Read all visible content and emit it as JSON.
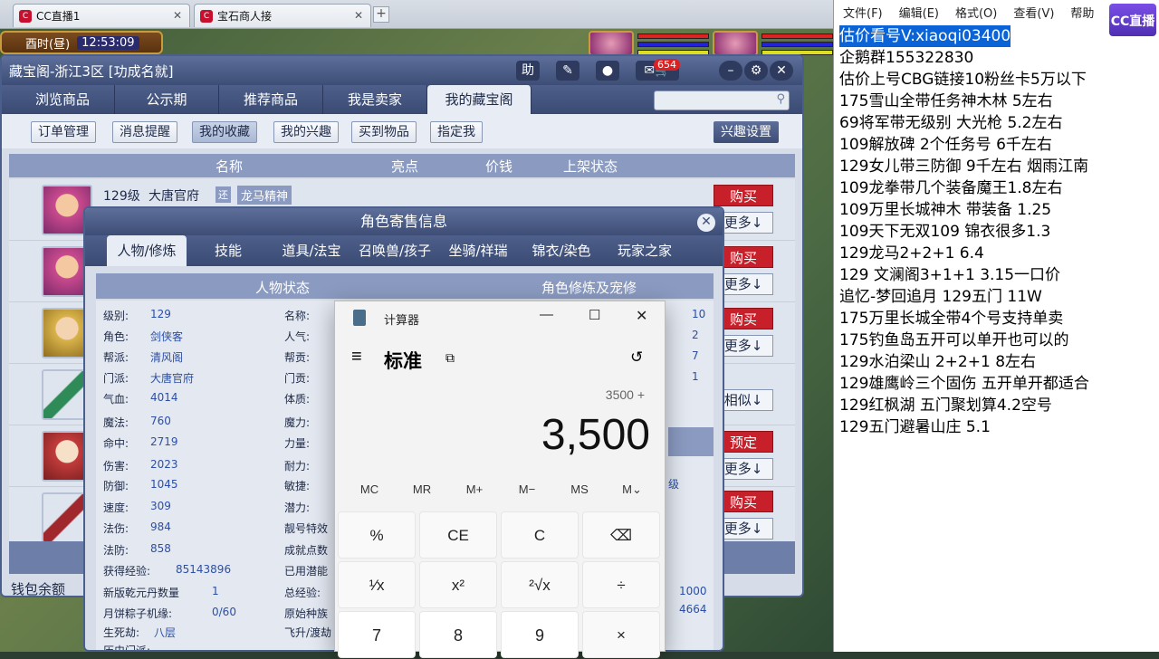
{
  "browser": {
    "tabs": [
      {
        "label": "CC直播1",
        "close": "✕"
      },
      {
        "label": "宝石商人接",
        "close": "✕"
      }
    ],
    "new_tab": "+"
  },
  "game": {
    "time_label": "酉时(昼)",
    "clock": "12:53:09"
  },
  "market": {
    "title": "藏宝阁-浙江3区 [功成名就]",
    "help_label": "助",
    "message_count": "654",
    "nav_tabs": [
      "浏览商品",
      "公示期",
      "推荐商品",
      "我是卖家",
      "我的藏宝阁"
    ],
    "active_tab": 4,
    "sub_buttons": [
      "订单管理",
      "消息提醒",
      "我的收藏",
      "我的兴趣",
      "买到物品",
      "指定我"
    ],
    "interest_settings": "兴趣设置",
    "columns": [
      "名称",
      "亮点",
      "价钱",
      "上架状态"
    ],
    "first_item": {
      "level": "129级",
      "school": "大唐官府",
      "tag1": "还",
      "tag2": "龙马精神"
    },
    "buy_label": "购买",
    "more_label": "更多↓",
    "similar_label": "相似↓",
    "reserve_label": "预定",
    "wallet_label": "钱包余额"
  },
  "role_dialog": {
    "title": "角色寄售信息",
    "close": "✕",
    "tabs": [
      "人物/修炼",
      "技能",
      "道具/法宝",
      "召唤兽/孩子",
      "坐骑/祥瑞",
      "锦衣/染色",
      "玩家之家"
    ],
    "section_left": "人物状态",
    "section_right": "角色修炼及宠修",
    "stats": [
      {
        "label": "级别:",
        "value": "129"
      },
      {
        "label": "角色:",
        "value": "剑侠客"
      },
      {
        "label": "帮派:",
        "value": "清风阁"
      },
      {
        "label": "门派:",
        "value": "大唐官府"
      },
      {
        "label": "气血:",
        "value": "4014"
      },
      {
        "label": "魔法:",
        "value": "760"
      },
      {
        "label": "命中:",
        "value": "2719"
      },
      {
        "label": "伤害:",
        "value": "2023"
      },
      {
        "label": "防御:",
        "value": "1045"
      },
      {
        "label": "速度:",
        "value": "309"
      },
      {
        "label": "法伤:",
        "value": "984"
      },
      {
        "label": "法防:",
        "value": "858"
      },
      {
        "label": "获得经验:",
        "value": "85143896"
      },
      {
        "label": "新版乾元丹数量",
        "value": "1"
      },
      {
        "label": "月饼粽子机缘:",
        "value": "0/60"
      },
      {
        "label": "生死劫:",
        "value": "八层"
      },
      {
        "label": "历史门派:",
        "value": ""
      }
    ],
    "stats2": [
      "名称:",
      "人气:",
      "帮贡:",
      "门贡:",
      "体质:",
      "魔力:",
      "力量:",
      "耐力:",
      "敏捷:",
      "潜力:",
      "靓号特效",
      "成就点数",
      "已用潜能",
      "总经验:",
      "原始种族",
      "飞升/渡劫"
    ],
    "right_values": [
      "10",
      "2",
      "7",
      "1"
    ],
    "right_level": "级",
    "bottom_values": [
      "1000",
      "4664"
    ]
  },
  "calculator": {
    "title": "计算器",
    "mode": "标准",
    "expression": "3500 +",
    "display": "3,500",
    "memory": [
      "MC",
      "MR",
      "M+",
      "M−",
      "MS",
      "M⌄"
    ],
    "keys": [
      "%",
      "CE",
      "C",
      "⌫",
      "¹⁄x",
      "x²",
      "²√x",
      "÷",
      "7",
      "8",
      "9",
      "×"
    ]
  },
  "notepad": {
    "menu": [
      "文件(F)",
      "编辑(E)",
      "格式(O)",
      "查看(V)",
      "帮助"
    ],
    "logo": "CC直播",
    "lines": [
      "估价看号V:xiaoqi03400",
      "企鹅群155322830",
      "估价上号CBG链接10粉丝卡5万以下",
      "175雪山全带任务神木林 5左右",
      "69将军带无级别 大光枪 5.2左右",
      "109解放碑 2个任务号 6千左右",
      "129女儿带三防御 9千左右 烟雨江南",
      "109龙拳带几个装备魔王1.8左右",
      "109万里长城神木 带装备  1.25",
      "109天下无双109  锦衣很多1.3",
      "129龙马2+2+1  6.4",
      "129 文澜阁3+1+1   3.15一口价",
      "追忆-梦回追月 129五门 11W",
      "175万里长城全带4个号支持单卖",
      "175钓鱼岛五开可以单开也可以的",
      "129水泊梁山 2+2+1 8左右",
      "129雄鹰岭三个固伤 五开单开都适合",
      "129红枫湖 五门聚划算4.2空号",
      "129五门避暑山庄  5.1"
    ]
  }
}
